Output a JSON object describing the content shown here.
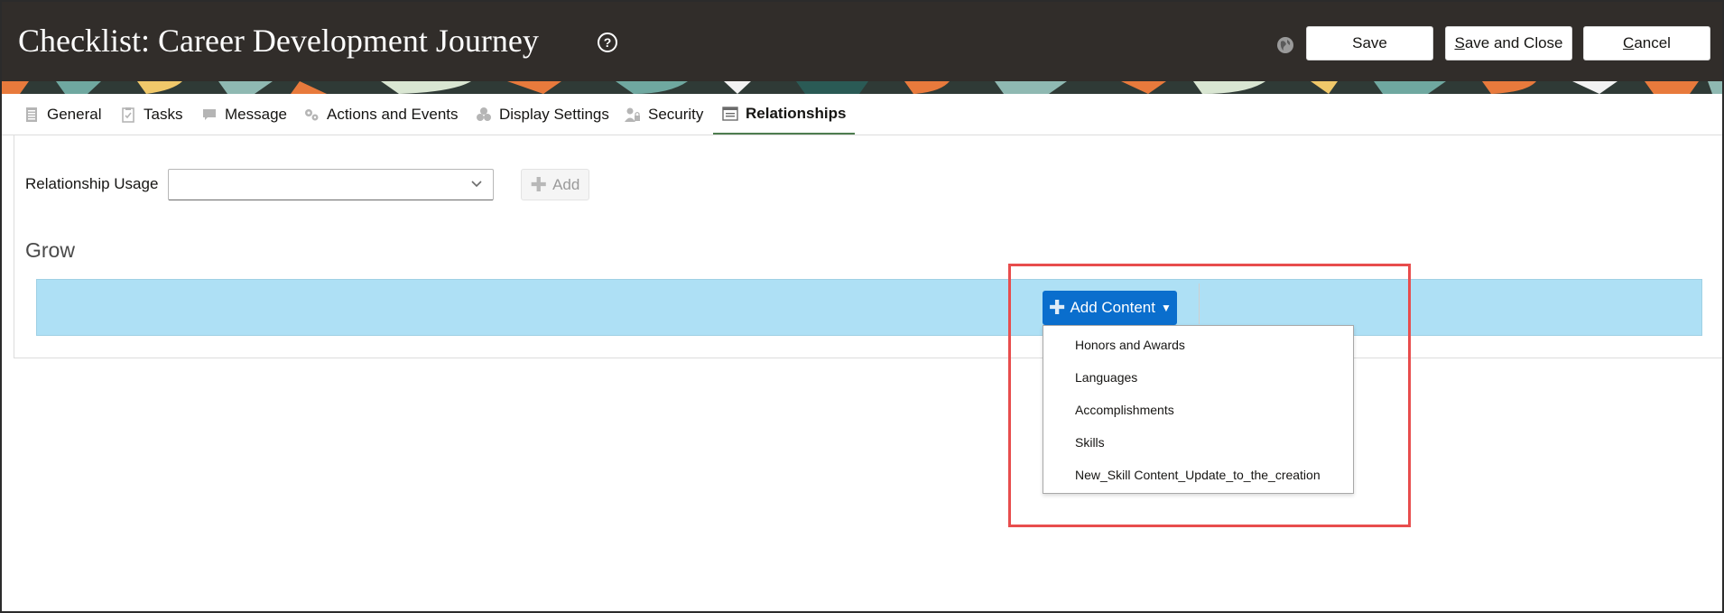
{
  "header": {
    "title": "Checklist: Career Development Journey",
    "help_icon": "?",
    "globe_icon": "globe-icon",
    "buttons": {
      "save": "Save",
      "save_close_first": "S",
      "save_close_rest": "ave and Close",
      "cancel_first": "C",
      "cancel_rest": "ancel"
    },
    "background_color": "#312d2a"
  },
  "tabs": [
    {
      "label": "General",
      "icon": "document-icon",
      "active": false
    },
    {
      "label": "Tasks",
      "icon": "clipboard-icon",
      "active": false
    },
    {
      "label": "Message",
      "icon": "message-icon",
      "active": false
    },
    {
      "label": "Actions and Events",
      "icon": "gears-icon",
      "active": false
    },
    {
      "label": "Display Settings",
      "icon": "circles-icon",
      "active": false
    },
    {
      "label": "Security",
      "icon": "user-lock-icon",
      "active": false
    },
    {
      "label": "Relationships",
      "icon": "list-card-icon",
      "active": true
    }
  ],
  "relationships": {
    "usage_label": "Relationship Usage",
    "usage_value": "",
    "add_label": "Add"
  },
  "grow": {
    "title": "Grow",
    "add_content_label": "Add Content",
    "menu_items": [
      "Honors and Awards",
      "Languages",
      "Accomplishments",
      "Skills",
      "New_Skill Content_Update_to_the_creation"
    ]
  },
  "colors": {
    "accent_blue": "#0a6ecd",
    "drop_zone": "#aee0f5",
    "active_tab_underline": "#4e7d4f",
    "highlight": "#e84d4d"
  }
}
